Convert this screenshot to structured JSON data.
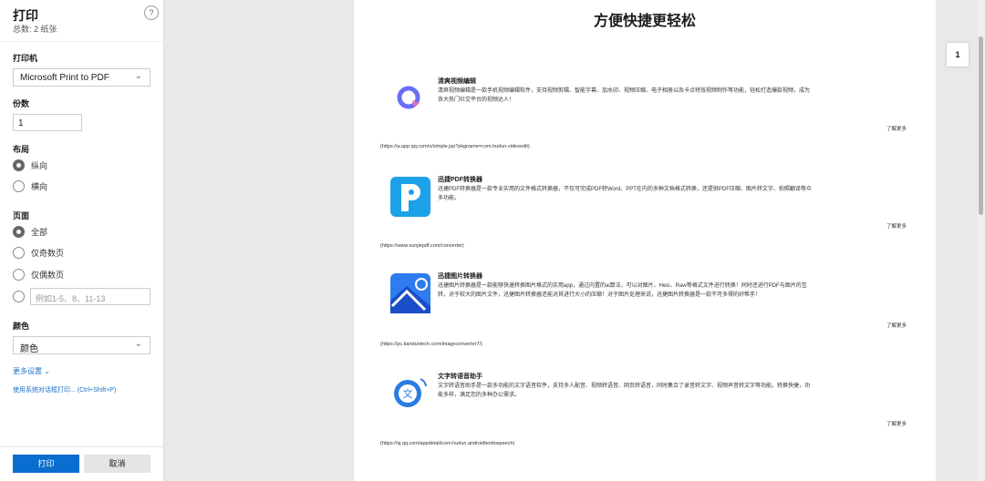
{
  "panel": {
    "title": "打印",
    "total": "总数: 2 纸张",
    "help": "?",
    "printer_label": "打印机",
    "printer": "Microsoft Print to PDF",
    "copies_label": "份数",
    "copies": "1",
    "layout_label": "布局",
    "portrait": "纵向",
    "landscape": "横向",
    "pages_label": "页面",
    "all": "全部",
    "odd": "仅奇数页",
    "even": "仅偶数页",
    "custom_placeholder": "例如1-5、8、11-13",
    "color_label": "颜色",
    "color": "颜色",
    "more_settings": "更多设置 ⌄",
    "system_dialog": "使用系统对话框打印... (Ctrl+Shift+P)",
    "print": "打印",
    "cancel": "取消"
  },
  "preview": {
    "heading": "方便快捷更轻松",
    "page_number": "1",
    "items": [
      {
        "title": "清爽视频编辑",
        "desc": "清爽视频编辑是一款手机视频编辑软件，支持视频剪辑、智能字幕、加水印、视频压缩、电子相册以及卡点特效视频制作等功能，轻松打造爆款视频，成为各大热门社交平台的视频达人！",
        "more": "了解更多",
        "url": "(https://a.app.qq.com/o/simple.jsp?pkgname=com.hudun.videoedit)"
      },
      {
        "title": "迅捷PDF转换器",
        "desc": "迅捷PDF转换器是一款专业实用的文件格式转换器，不仅可完成PDF转Word、PPT在内的多种文档格式转换，还提供PDF压缩、图片转文字、拍照翻译等众多功能。",
        "more": "了解更多",
        "url": "(https://www.xunjiepdf.com/converter)"
      },
      {
        "title": "迅捷图片转换器",
        "desc": "迅捷图片转换器是一款能够快速转换图片格式的实用app，通过内置的ai算法，可以对图片、Heic、Raw等格式文件进行转换！同时还进行PDF与图片的互转，对于较大的图片文件，迅捷图片转换器还能对其进行大小的压缩！对于图片处理来说，迅捷图片转换器是一款不可多得的好帮手！",
        "more": "了解更多",
        "url": "(https://pc.tianduntech.com/imageconverter7/)"
      },
      {
        "title": "文字转语音助手",
        "desc": "文字转语音助手是一款多功能的文字语音软件，支持多人配音、视频转语音、网页转语音，同时集合了录音转文字、视频声音转文字等功能。转换快捷，功能多样，满足您的多种办公需求。",
        "more": "了解更多",
        "url": "(https://sj.qq.com/appdetail/com.hudun.androidtexttospeech)"
      }
    ]
  }
}
